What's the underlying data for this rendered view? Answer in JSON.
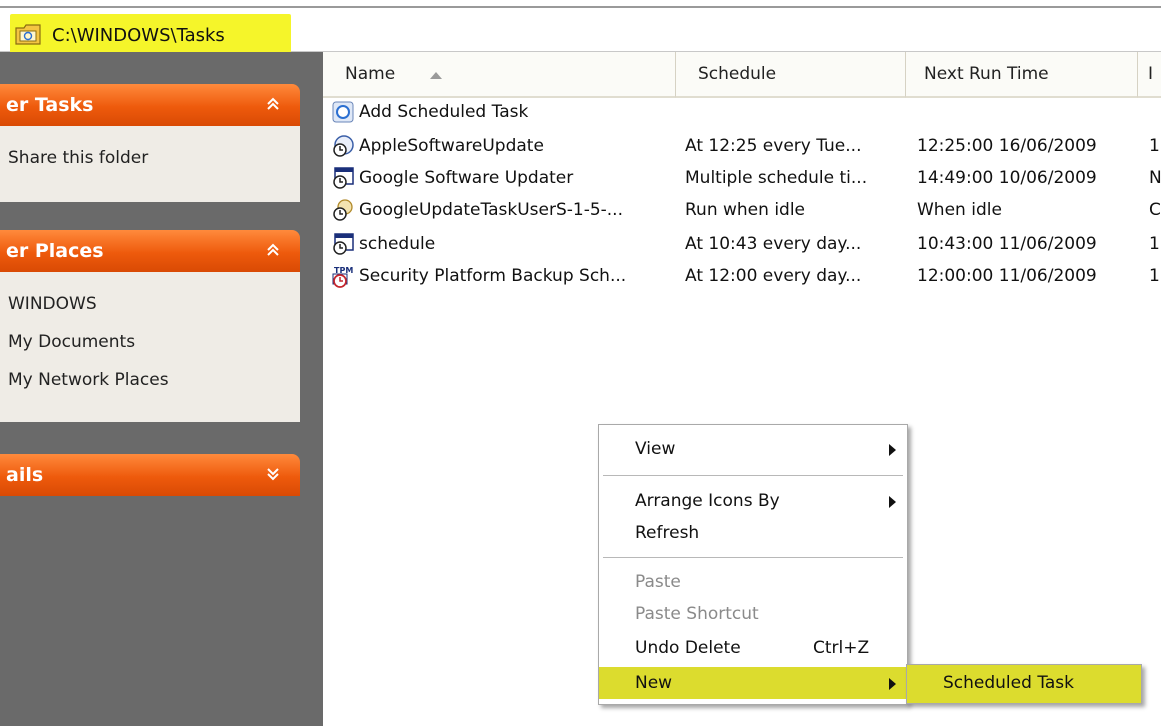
{
  "address": {
    "path": "C:\\WINDOWS\\Tasks"
  },
  "sidebar": {
    "panels": [
      {
        "title": "er Tasks",
        "links": [
          "Share this folder"
        ]
      },
      {
        "title": "er Places",
        "links": [
          "WINDOWS",
          "My Documents",
          "My Network Places"
        ]
      },
      {
        "title": "ails",
        "links": []
      }
    ]
  },
  "list": {
    "columns": [
      "Name",
      "Schedule",
      "Next Run Time",
      "I"
    ],
    "rows": [
      {
        "name": "Add Scheduled Task",
        "schedule": "",
        "next_run": "",
        "extra": "",
        "icon": "add-task-icon"
      },
      {
        "name": "AppleSoftwareUpdate",
        "schedule": "At 12:25 every Tue...",
        "next_run": "12:25:00  16/06/2009",
        "extra": "1",
        "icon": "scheduled-task-icon"
      },
      {
        "name": "Google Software Updater",
        "schedule": "Multiple schedule ti...",
        "next_run": "14:49:00  10/06/2009",
        "extra": "N",
        "icon": "scheduled-task-icon"
      },
      {
        "name": "GoogleUpdateTaskUserS-1-5-...",
        "schedule": "Run when idle",
        "next_run": "When idle",
        "extra": "C",
        "icon": "scheduled-task-icon"
      },
      {
        "name": "schedule",
        "schedule": "At 10:43 every day...",
        "next_run": "10:43:00  11/06/2009",
        "extra": "1",
        "icon": "scheduled-task-icon"
      },
      {
        "name": "Security Platform Backup Sch...",
        "schedule": "At 12:00 every day...",
        "next_run": "12:00:00  11/06/2009",
        "extra": "1",
        "icon": "tpm-task-icon"
      }
    ]
  },
  "context_menu": {
    "view": "View",
    "arrange": "Arrange Icons By",
    "refresh": "Refresh",
    "paste": "Paste",
    "paste_shortcut": "Paste Shortcut",
    "undo_delete": "Undo Delete",
    "undo_shortcut": "Ctrl+Z",
    "new": "New",
    "submenu_item": "Scheduled Task"
  },
  "colors": {
    "highlight": "#dcdc2e",
    "panel_orange": "#ee5a0c",
    "address_highlight": "#f5f52a"
  }
}
